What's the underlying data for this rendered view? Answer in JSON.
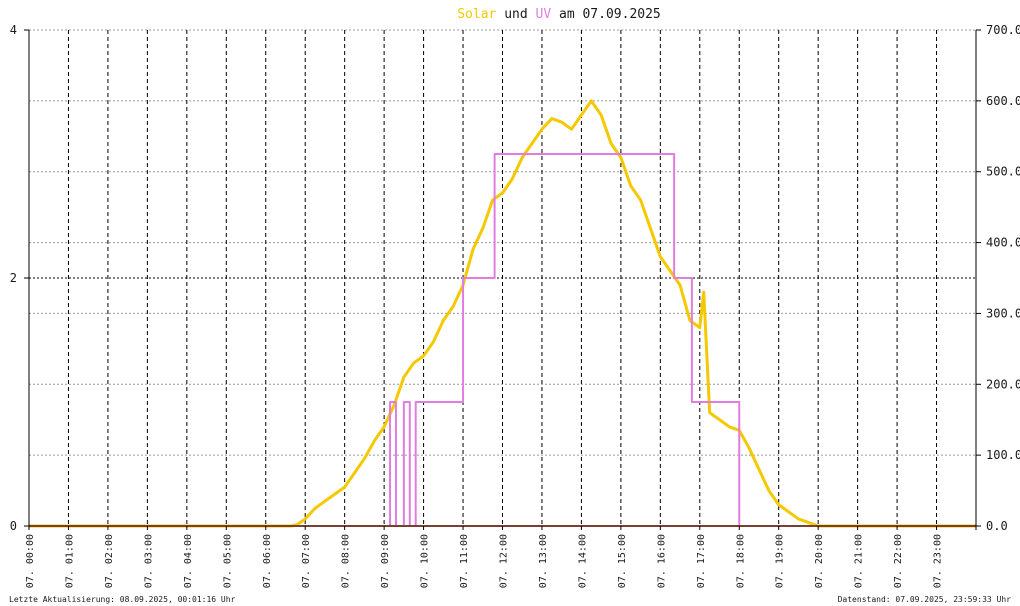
{
  "title": {
    "part1": "Solar",
    "part2": " und ",
    "part3": "UV",
    "part4": " am 07.09.2025"
  },
  "colors": {
    "solar": "#f5c800",
    "uv": "#e07ee0",
    "uv_baseline": "#f08060",
    "title_text": "#1a1a1a",
    "grid_major": "#000000",
    "grid_minor": "#999999",
    "background": "#ffffff"
  },
  "footer": {
    "left": "Letzte Aktualisierung: 08.09.2025, 00:01:16 Uhr",
    "right": "Datenstand: 07.09.2025, 23:59:33 Uhr"
  },
  "chart_data": {
    "type": "line",
    "title": "Solar und UV am 07.09.2025",
    "xlabel": "",
    "ylabel_left": "",
    "ylabel_right": "",
    "x_range_hours": [
      0,
      24
    ],
    "x_ticks": [
      "07. 00:00",
      "07. 01:00",
      "07. 02:00",
      "07. 03:00",
      "07. 04:00",
      "07. 05:00",
      "07. 06:00",
      "07. 07:00",
      "07. 08:00",
      "07. 09:00",
      "07. 10:00",
      "07. 11:00",
      "07. 12:00",
      "07. 13:00",
      "07. 14:00",
      "07. 15:00",
      "07. 16:00",
      "07. 17:00",
      "07. 18:00",
      "07. 19:00",
      "07. 20:00",
      "07. 21:00",
      "07. 22:00",
      "07. 23:00"
    ],
    "y_left": {
      "range": [
        0,
        4
      ],
      "ticks": [
        "0",
        "2",
        "4"
      ],
      "tick_values": [
        0,
        2,
        4
      ]
    },
    "y_right": {
      "range": [
        0,
        700
      ],
      "ticks": [
        "0.0",
        "100.0",
        "200.0",
        "300.0",
        "400.0",
        "500.0",
        "600.0",
        "700.0"
      ],
      "tick_values": [
        0,
        100,
        200,
        300,
        400,
        500,
        600,
        700
      ]
    },
    "grid": true,
    "legend": "title",
    "series": [
      {
        "name": "Solar",
        "axis": "right",
        "x": [
          0,
          6.65,
          6.8,
          7.0,
          7.25,
          7.5,
          7.75,
          8.0,
          8.25,
          8.5,
          8.75,
          9.0,
          9.25,
          9.5,
          9.75,
          10.0,
          10.25,
          10.5,
          10.75,
          11.0,
          11.25,
          11.5,
          11.75,
          12.0,
          12.25,
          12.5,
          12.75,
          13.0,
          13.25,
          13.5,
          13.75,
          14.0,
          14.25,
          14.5,
          14.75,
          15.0,
          15.25,
          15.5,
          15.75,
          16.0,
          16.25,
          16.5,
          16.75,
          17.0,
          17.1,
          17.25,
          17.5,
          17.75,
          18.0,
          18.25,
          18.5,
          18.75,
          19.0,
          19.25,
          19.5,
          19.75,
          20.0,
          24
        ],
        "y": [
          0,
          0,
          2,
          10,
          25,
          35,
          45,
          55,
          75,
          95,
          120,
          140,
          170,
          210,
          230,
          240,
          260,
          290,
          310,
          340,
          390,
          420,
          460,
          470,
          490,
          520,
          540,
          560,
          575,
          570,
          560,
          580,
          600,
          580,
          540,
          520,
          480,
          460,
          420,
          380,
          360,
          340,
          290,
          280,
          330,
          160,
          150,
          140,
          135,
          110,
          80,
          50,
          30,
          20,
          10,
          5,
          0,
          0
        ]
      },
      {
        "name": "UV",
        "axis": "left",
        "x": [
          0,
          9.1,
          9.15,
          9.25,
          9.3,
          9.5,
          9.6,
          9.65,
          9.75,
          9.8,
          9.85,
          10.0,
          10.95,
          11.0,
          11.3,
          11.35,
          11.75,
          11.8,
          12.5,
          12.55,
          13.7,
          13.75,
          14.95,
          15.0,
          16.3,
          16.35,
          16.75,
          16.8,
          17.95,
          18.0,
          24
        ],
        "y": [
          0,
          0,
          1,
          1,
          0,
          1,
          1,
          0,
          0,
          1,
          1,
          1,
          1,
          2,
          2,
          2,
          2,
          3,
          3,
          3,
          3,
          3,
          3,
          3,
          3,
          2,
          2,
          1,
          1,
          0,
          0
        ]
      }
    ]
  }
}
